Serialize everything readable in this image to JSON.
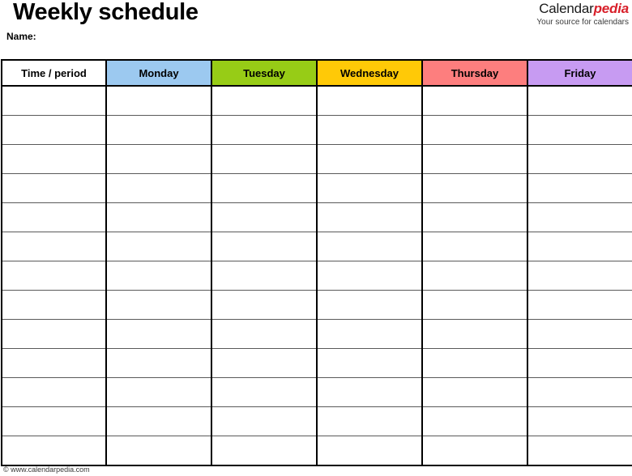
{
  "document": {
    "title": "Weekly schedule",
    "name_label": "Name:"
  },
  "brand": {
    "name_main": "Calendar",
    "name_accent": "pedia",
    "tagline": "Your source for calendars",
    "main_color": "#1a1a1a",
    "accent_color": "#d8202a"
  },
  "table": {
    "columns": [
      {
        "label": "Time / period",
        "bg": "#ffffff"
      },
      {
        "label": "Monday",
        "bg": "#9cc9f0"
      },
      {
        "label": "Tuesday",
        "bg": "#97cc16"
      },
      {
        "label": "Wednesday",
        "bg": "#ffc907"
      },
      {
        "label": "Thursday",
        "bg": "#fd7e7e"
      },
      {
        "label": "Friday",
        "bg": "#c79bf2"
      }
    ],
    "row_count": 13,
    "grid": {
      "outer_border_color": "#000000",
      "column_border_color": "#000000",
      "row_border_color": "#5a5a5a",
      "cell_background": "#ffffff"
    }
  },
  "footer": {
    "copyright": "© www.calendarpedia.com"
  }
}
